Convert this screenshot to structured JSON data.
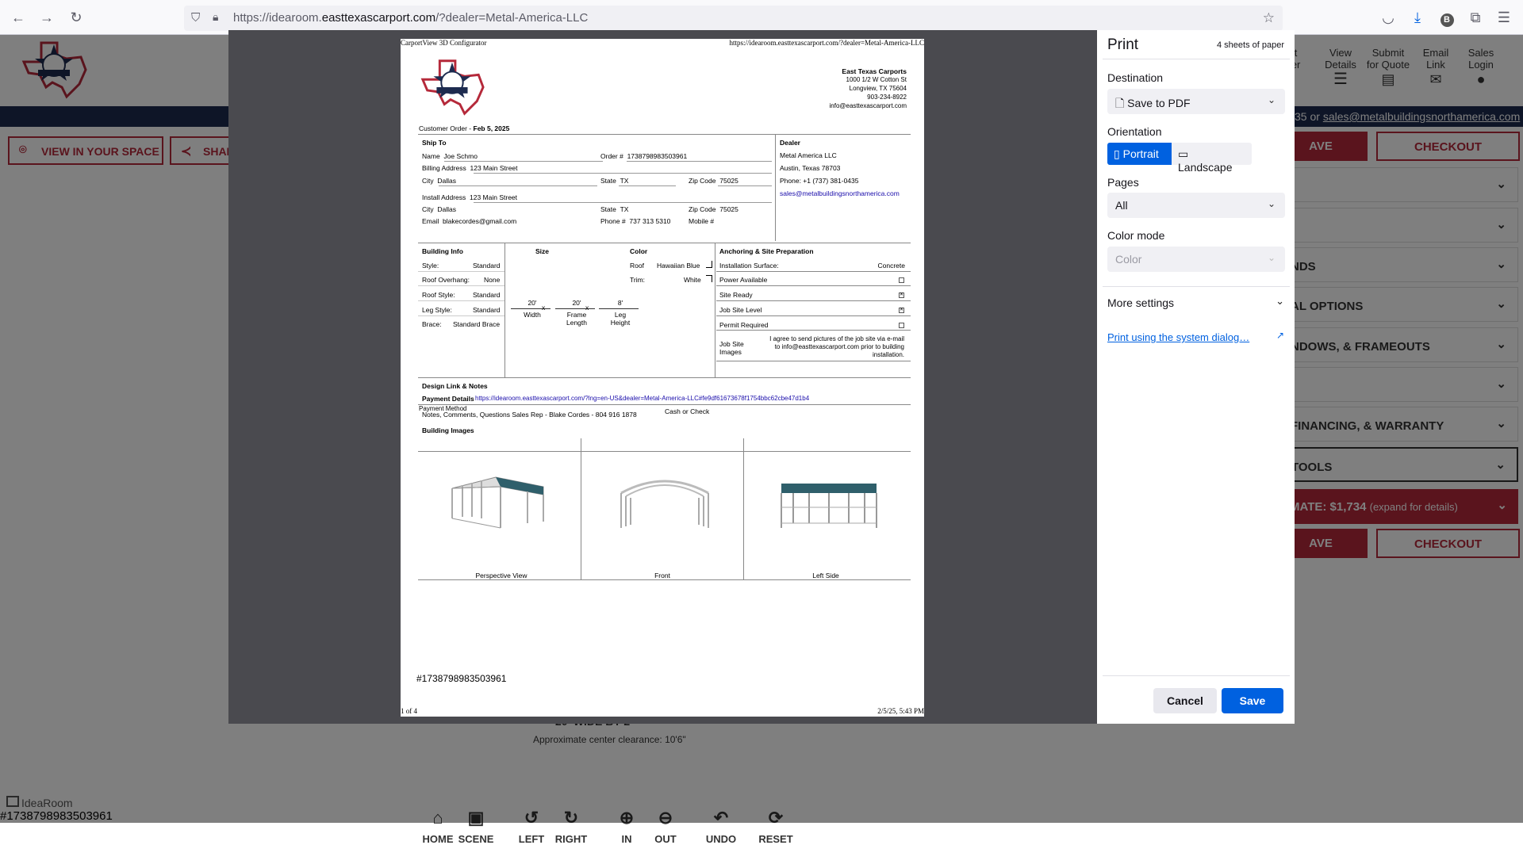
{
  "browser": {
    "url_prefix": "https://idearoom.",
    "url_domain": "easttexascarport.com",
    "url_path": "/?dealer=Metal-America-LLC"
  },
  "page": {
    "nav": [
      {
        "label_line1": "nt",
        "label_line2": "der"
      },
      {
        "label_line1": "View",
        "label_line2": "Details"
      },
      {
        "label_line1": "Submit",
        "label_line2": "for Quote"
      },
      {
        "label_line1": "Email",
        "label_line2": "Link"
      },
      {
        "label_line1": "Sales",
        "label_line2": "Login"
      }
    ],
    "contact_prefix": "35 or",
    "contact_email": "sales@metalbuildingsnorthamerica.com",
    "view_in_space": "VIEW IN YOUR SPACE",
    "share": "SHAR",
    "save_label": "AVE",
    "checkout_label": "CHECKOUT",
    "accordions": [
      "",
      "",
      "NDS",
      "AL OPTIONS",
      "NDOWS, & FRAMEOUTS",
      "",
      "FINANCING, & WARRANTY",
      "TOOLS"
    ],
    "estimate": "MATE: $1,734",
    "estimate_note": "(expand for details)",
    "size_title": "20' WIDE BY 2",
    "clearance": "Approximate center clearance: 10'6\"",
    "controls": [
      "HOME",
      "SCENE",
      "LEFT",
      "RIGHT",
      "IN",
      "OUT",
      "UNDO",
      "RESET"
    ],
    "brand": "IdeaRoom",
    "order_number": "#1738798983503961"
  },
  "sheet": {
    "header_left": "CarportView 3D Configurator",
    "header_right": "https://idearoom.easttexascarport.com/?dealer=Metal-America-LLC",
    "company": "East Texas Carports",
    "address1": "1000 1/2 W Cotton St",
    "address2": "Longview, TX 75604",
    "phone": "903-234-8922",
    "email": "info@easttexascarport.com",
    "customer_order_label": "Customer Order -",
    "customer_order_date": "Feb 5, 2025",
    "ship_to": "Ship To",
    "name_label": "Name",
    "name": "Joe Schmo",
    "order_label": "Order #",
    "order": "1738798983503961",
    "billing_label": "Billing Address",
    "billing": "123 Main Street",
    "city_label": "City",
    "city": "Dallas",
    "state_label": "State",
    "state": "TX",
    "zip_label": "Zip Code",
    "zip": "75025",
    "install_label": "Install Address",
    "install": "123 Main Street",
    "email_label": "Email",
    "cust_email": "blakecordes@gmail.com",
    "phone_label": "Phone #",
    "cust_phone": "737 313 5310",
    "mobile_label": "Mobile #",
    "dealer_title": "Dealer",
    "dealer_name": "Metal America LLC",
    "dealer_city": "Austin, Texas 78703",
    "dealer_phone": "Phone: +1 (737) 381-0435",
    "dealer_email": "sales@metalbuildingsnorthamerica.com",
    "building_info": "Building Info",
    "style_label": "Style:",
    "style": "Standard",
    "overhang_label": "Roof Overhang:",
    "overhang": "None",
    "roof_style_label": "Roof Style:",
    "roof_style": "Standard",
    "leg_style_label": "Leg Style:",
    "leg_style": "Standard",
    "brace_label": "Brace:",
    "brace": "Standard Brace",
    "size_title": "Size",
    "width_val": "20'",
    "width_label": "Width",
    "frame_val": "20'",
    "frame_label1": "Frame",
    "frame_label2": "Length",
    "leg_val": "8'",
    "leg_label1": "Leg",
    "leg_label2": "Height",
    "x": "x",
    "color_title": "Color",
    "roof_label": "Roof",
    "roof_color": "Hawaiian Blue",
    "trim_label": "Trim:",
    "trim_color": "White",
    "anchoring_title": "Anchoring & Site Preparation",
    "surface_label": "Installation Surface:",
    "surface": "Concrete",
    "power": "Power Available",
    "site_ready": "Site Ready",
    "site_level": "Job Site Level",
    "permit": "Permit Required",
    "job_images_label1": "Job Site",
    "job_images_label2": "Images",
    "job_images_text": "I agree to send pictures of the job site via e-mail to info@easttexascarport.com prior to building installation.",
    "design_link_title": "Design Link & Notes",
    "payment_details": "Payment Details",
    "link": "https://idearoom.easttexascarport.com/?lng=en-US&dealer=Metal-America-LLC#fe9df61673678f1754bbc62cbe47d1b4",
    "payment_method_label": "Payment Method",
    "notes": "Notes, Comments, Questions Sales Rep - Blake Cordes - 804 916 1878",
    "payment_method": "Cash or Check",
    "building_images": "Building Images",
    "views": [
      "Perspective View",
      "Front",
      "Left Side"
    ],
    "order_number": "#1738798983503961",
    "footer_left": "1 of 4",
    "footer_right": "2/5/25, 5:43 PM"
  },
  "print": {
    "title": "Print",
    "sheets": "4 sheets of paper",
    "destination_label": "Destination",
    "destination": "Save to PDF",
    "orientation_label": "Orientation",
    "portrait": "Portrait",
    "landscape": "Landscape",
    "pages_label": "Pages",
    "pages": "All",
    "color_label": "Color mode",
    "color": "Color",
    "more_settings": "More settings",
    "system_dialog": "Print using the system dialog…",
    "cancel": "Cancel",
    "save": "Save"
  },
  "colors": {
    "accent": "#0061e0",
    "brand_red": "#b5293a",
    "navy": "#1d2b4f"
  }
}
